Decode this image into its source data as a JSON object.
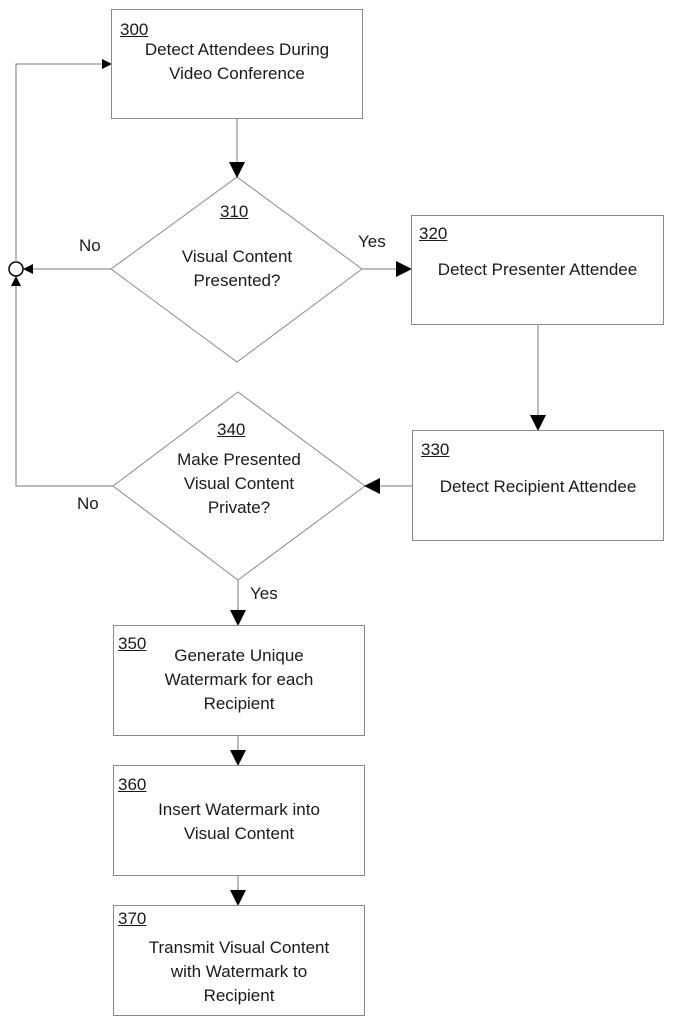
{
  "steps": {
    "s300": {
      "number": "300",
      "lines": [
        "Detect Attendees During",
        "Video Conference"
      ]
    },
    "s310": {
      "number": "310",
      "lines": [
        "Visual Content",
        "Presented?"
      ]
    },
    "s320": {
      "number": "320",
      "lines": [
        "Detect Presenter Attendee"
      ]
    },
    "s330": {
      "number": "330",
      "lines": [
        "Detect Recipient Attendee"
      ]
    },
    "s340": {
      "number": "340",
      "lines": [
        "Make Presented",
        "Visual Content",
        "Private?"
      ]
    },
    "s350": {
      "number": "350",
      "lines": [
        "Generate Unique",
        "Watermark for each",
        "Recipient"
      ]
    },
    "s360": {
      "number": "360",
      "lines": [
        "Insert Watermark into",
        "Visual Content"
      ]
    },
    "s370": {
      "number": "370",
      "lines": [
        "Transmit Visual Content",
        "with Watermark to",
        "Recipient"
      ]
    }
  },
  "edge_labels": {
    "d310_no": "No",
    "d310_yes": "Yes",
    "d340_no": "No",
    "d340_yes": "Yes"
  },
  "colors": {
    "line": "#7a7a7a",
    "arrow": "#000000",
    "text": "#1a1a1a"
  }
}
